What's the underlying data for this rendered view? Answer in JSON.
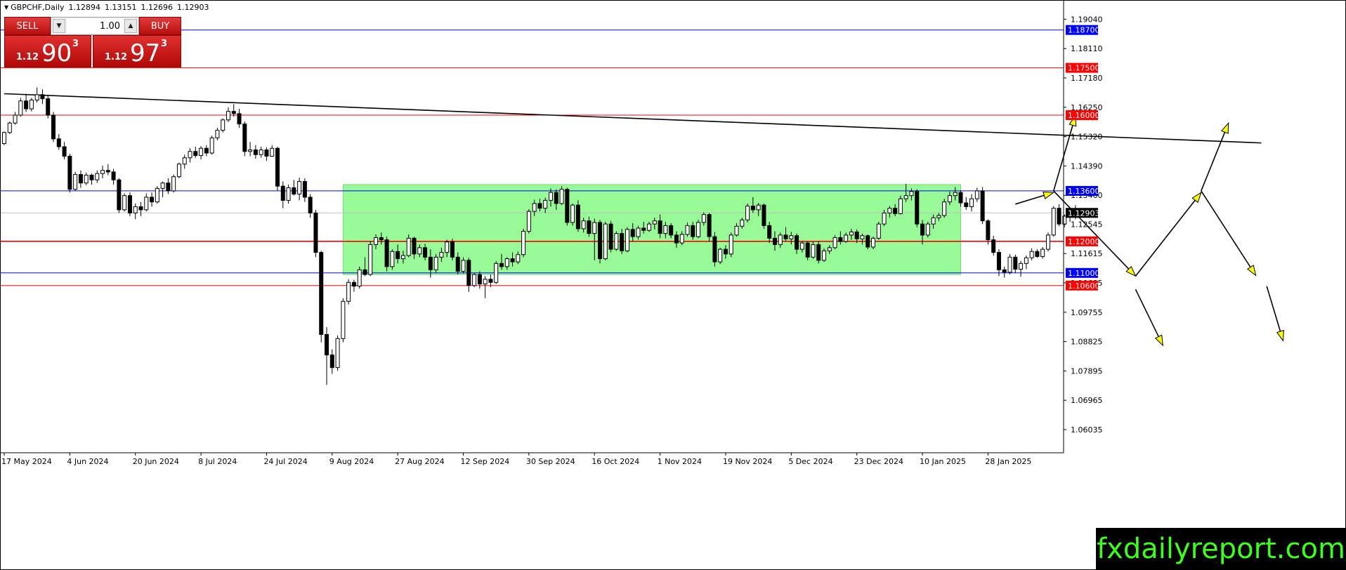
{
  "header": {
    "symbol": "GBPCHF,Daily",
    "open": "1.12894",
    "high": "1.13151",
    "low": "1.12696",
    "close": "1.12903"
  },
  "trade_panel": {
    "sell_label": "SELL",
    "buy_label": "BUY",
    "lot_value": "1.00",
    "sell_price": {
      "small": "1.12",
      "big": "90",
      "sup": "3"
    },
    "buy_price": {
      "small": "1.12",
      "big": "97",
      "sup": "3"
    }
  },
  "brand": "fxdailyreport.com",
  "colors": {
    "background": "#ffffff",
    "bull_candle": "#ffffff",
    "bear_candle": "#000000",
    "range_box": "#98fb98",
    "red_level": "#ff0000",
    "blue_level": "#0000ff",
    "trade_red": "#cc1414",
    "arrow_fill": "#ffff00",
    "brand_text": "#3cff1a"
  },
  "chart_data": {
    "type": "candlestick",
    "title": "GBPCHF,Daily",
    "ylim": [
      1.053,
      1.1965
    ],
    "y_ticks": [
      "1.19040",
      "1.18110",
      "1.17180",
      "1.16250",
      "1.15320",
      "1.14390",
      "1.13460",
      "1.12545",
      "1.11615",
      "1.10685",
      "1.09755",
      "1.08825",
      "1.07895",
      "1.06965",
      "1.06035"
    ],
    "x_labels": [
      "17 May 2024",
      "4 Jun 2024",
      "20 Jun 2024",
      "8 Jul 2024",
      "24 Jul 2024",
      "9 Aug 2024",
      "27 Aug 2024",
      "12 Sep 2024",
      "30 Sep 2024",
      "16 Oct 2024",
      "1 Nov 2024",
      "19 Nov 2024",
      "5 Dec 2024",
      "23 Dec 2024",
      "10 Jan 2025",
      "28 Jan 2025"
    ],
    "x_label_bar_index": [
      0,
      12,
      24,
      36,
      48,
      60,
      72,
      84,
      96,
      108,
      120,
      132,
      144,
      156,
      168,
      180
    ],
    "horizontal_levels": [
      {
        "price": 1.187,
        "label": "1.18700",
        "color": "blue"
      },
      {
        "price": 1.175,
        "label": "1.17500",
        "color": "red"
      },
      {
        "price": 1.16,
        "label": "1.16000",
        "color": "red"
      },
      {
        "price": 1.136,
        "label": "1.13600",
        "color": "blue"
      },
      {
        "price": 1.12,
        "label": "1.12000",
        "color": "red"
      },
      {
        "price": 1.11,
        "label": "1.11000",
        "color": "blue"
      },
      {
        "price": 1.106,
        "label": "1.10600",
        "color": "red"
      }
    ],
    "current_price": {
      "price": 1.12903,
      "label": "1.12903"
    },
    "range_box": {
      "bar_start": 62,
      "bar_end": 175,
      "top": 1.138,
      "bottom": 1.1095
    },
    "trendline": {
      "from": {
        "bar": 0,
        "price": 1.1668
      },
      "to": {
        "bar": 230,
        "price": 1.1512
      }
    },
    "scenario_arrows": [
      [
        {
          "bar": 185,
          "price": 1.1318
        },
        {
          "bar": 192,
          "price": 1.1355
        }
      ],
      [
        {
          "bar": 192,
          "price": 1.136
        },
        {
          "bar": 196,
          "price": 1.1598
        }
      ],
      [
        {
          "bar": 192,
          "price": 1.136
        },
        {
          "bar": 207,
          "price": 1.109
        }
      ],
      [
        {
          "bar": 207,
          "price": 1.109
        },
        {
          "bar": 219,
          "price": 1.1355
        }
      ],
      [
        {
          "bar": 219,
          "price": 1.136
        },
        {
          "bar": 224,
          "price": 1.1575
        }
      ],
      [
        {
          "bar": 219,
          "price": 1.136
        },
        {
          "bar": 229,
          "price": 1.1092
        }
      ],
      [
        {
          "bar": 207,
          "price": 1.1048
        },
        {
          "bar": 212,
          "price": 1.087
        }
      ],
      [
        {
          "bar": 231,
          "price": 1.1058
        },
        {
          "bar": 234,
          "price": 1.0885
        }
      ]
    ],
    "ohlc": [
      [
        1.151,
        1.1548,
        1.1505,
        1.1545
      ],
      [
        1.1545,
        1.158,
        1.154,
        1.1575
      ],
      [
        1.1575,
        1.161,
        1.157,
        1.16
      ],
      [
        1.16,
        1.1655,
        1.1595,
        1.1645
      ],
      [
        1.1645,
        1.1668,
        1.161,
        1.162
      ],
      [
        1.162,
        1.1655,
        1.1612,
        1.1648
      ],
      [
        1.1648,
        1.1688,
        1.164,
        1.1665
      ],
      [
        1.1665,
        1.1682,
        1.1635,
        1.1652
      ],
      [
        1.1652,
        1.1665,
        1.159,
        1.16
      ],
      [
        1.16,
        1.161,
        1.1515,
        1.1525
      ],
      [
        1.1525,
        1.154,
        1.149,
        1.15
      ],
      [
        1.15,
        1.1515,
        1.146,
        1.147
      ],
      [
        1.147,
        1.1478,
        1.1355,
        1.1365
      ],
      [
        1.1365,
        1.142,
        1.136,
        1.1412
      ],
      [
        1.1412,
        1.1425,
        1.137,
        1.1385
      ],
      [
        1.1385,
        1.1418,
        1.1378,
        1.141
      ],
      [
        1.141,
        1.1415,
        1.138,
        1.1395
      ],
      [
        1.1395,
        1.1425,
        1.1385,
        1.1415
      ],
      [
        1.1415,
        1.144,
        1.14,
        1.1425
      ],
      [
        1.1425,
        1.1445,
        1.141,
        1.142
      ],
      [
        1.142,
        1.143,
        1.138,
        1.1395
      ],
      [
        1.1395,
        1.14,
        1.129,
        1.13
      ],
      [
        1.13,
        1.1352,
        1.1295,
        1.1345
      ],
      [
        1.1345,
        1.1355,
        1.128,
        1.129
      ],
      [
        1.129,
        1.132,
        1.127,
        1.131
      ],
      [
        1.131,
        1.1325,
        1.128,
        1.13
      ],
      [
        1.13,
        1.1352,
        1.1295,
        1.134
      ],
      [
        1.134,
        1.1355,
        1.131,
        1.1325
      ],
      [
        1.1325,
        1.1375,
        1.132,
        1.1368
      ],
      [
        1.1368,
        1.139,
        1.134,
        1.1385
      ],
      [
        1.1385,
        1.14,
        1.135,
        1.136
      ],
      [
        1.136,
        1.1412,
        1.1355,
        1.1405
      ],
      [
        1.1405,
        1.145,
        1.14,
        1.1445
      ],
      [
        1.1445,
        1.1475,
        1.143,
        1.1465
      ],
      [
        1.1465,
        1.1495,
        1.145,
        1.1485
      ],
      [
        1.1485,
        1.15,
        1.1465,
        1.1472
      ],
      [
        1.1472,
        1.1502,
        1.146,
        1.1495
      ],
      [
        1.1495,
        1.1505,
        1.147,
        1.148
      ],
      [
        1.148,
        1.1535,
        1.1475,
        1.1528
      ],
      [
        1.1528,
        1.156,
        1.152,
        1.1552
      ],
      [
        1.1552,
        1.159,
        1.1545,
        1.1585
      ],
      [
        1.1585,
        1.1625,
        1.1578,
        1.1612
      ],
      [
        1.1612,
        1.1635,
        1.1595,
        1.1605
      ],
      [
        1.1605,
        1.162,
        1.156,
        1.1572
      ],
      [
        1.1572,
        1.158,
        1.147,
        1.1485
      ],
      [
        1.1485,
        1.1515,
        1.147,
        1.149
      ],
      [
        1.149,
        1.1505,
        1.1462,
        1.1475
      ],
      [
        1.1475,
        1.15,
        1.1465,
        1.149
      ],
      [
        1.149,
        1.1498,
        1.1455,
        1.147
      ],
      [
        1.147,
        1.1505,
        1.1468,
        1.1495
      ],
      [
        1.1495,
        1.15,
        1.136,
        1.1375
      ],
      [
        1.1375,
        1.139,
        1.1305,
        1.133
      ],
      [
        1.133,
        1.138,
        1.132,
        1.137
      ],
      [
        1.137,
        1.1395,
        1.1345,
        1.135
      ],
      [
        1.135,
        1.1402,
        1.133,
        1.139
      ],
      [
        1.139,
        1.14,
        1.1325,
        1.134
      ],
      [
        1.134,
        1.135,
        1.1275,
        1.129
      ],
      [
        1.129,
        1.13,
        1.115,
        1.1165
      ],
      [
        1.1165,
        1.117,
        1.088,
        1.0905
      ],
      [
        1.0905,
        1.0928,
        1.0745,
        1.084
      ],
      [
        1.084,
        1.0858,
        1.078,
        1.08
      ],
      [
        1.08,
        1.0902,
        1.079,
        1.0892
      ],
      [
        1.0892,
        1.102,
        1.088,
        1.101
      ],
      [
        1.101,
        1.108,
        1.1,
        1.107
      ],
      [
        1.107,
        1.1078,
        1.104,
        1.1058
      ],
      [
        1.1058,
        1.112,
        1.105,
        1.111
      ],
      [
        1.111,
        1.115,
        1.109,
        1.1095
      ],
      [
        1.1095,
        1.12,
        1.109,
        1.119
      ],
      [
        1.119,
        1.1222,
        1.1175,
        1.1212
      ],
      [
        1.1212,
        1.1228,
        1.119,
        1.1205
      ],
      [
        1.1205,
        1.1215,
        1.1105,
        1.112
      ],
      [
        1.112,
        1.1175,
        1.111,
        1.1168
      ],
      [
        1.1168,
        1.119,
        1.113,
        1.1145
      ],
      [
        1.1145,
        1.117,
        1.113,
        1.1155
      ],
      [
        1.1155,
        1.1222,
        1.115,
        1.121
      ],
      [
        1.121,
        1.1215,
        1.1145,
        1.116
      ],
      [
        1.116,
        1.119,
        1.115,
        1.118
      ],
      [
        1.118,
        1.1192,
        1.114,
        1.115
      ],
      [
        1.115,
        1.1175,
        1.1085,
        1.111
      ],
      [
        1.111,
        1.116,
        1.11,
        1.115
      ],
      [
        1.115,
        1.118,
        1.1135,
        1.1165
      ],
      [
        1.1165,
        1.1205,
        1.115,
        1.1198
      ],
      [
        1.1198,
        1.1208,
        1.114,
        1.115
      ],
      [
        1.115,
        1.1165,
        1.1095,
        1.1105
      ],
      [
        1.1105,
        1.115,
        1.1098,
        1.114
      ],
      [
        1.114,
        1.1148,
        1.104,
        1.106
      ],
      [
        1.106,
        1.11,
        1.1055,
        1.1095
      ],
      [
        1.1095,
        1.1105,
        1.105,
        1.1065
      ],
      [
        1.1065,
        1.109,
        1.102,
        1.108
      ],
      [
        1.108,
        1.1095,
        1.1055,
        1.107
      ],
      [
        1.107,
        1.1138,
        1.1065,
        1.113
      ],
      [
        1.113,
        1.116,
        1.111,
        1.112
      ],
      [
        1.112,
        1.115,
        1.111,
        1.1145
      ],
      [
        1.1145,
        1.1165,
        1.112,
        1.1135
      ],
      [
        1.1135,
        1.1168,
        1.1128,
        1.1158
      ],
      [
        1.1158,
        1.124,
        1.115,
        1.1232
      ],
      [
        1.1232,
        1.1302,
        1.1225,
        1.1295
      ],
      [
        1.1295,
        1.1332,
        1.128,
        1.132
      ],
      [
        1.132,
        1.1335,
        1.1295,
        1.1305
      ],
      [
        1.1305,
        1.1338,
        1.129,
        1.133
      ],
      [
        1.133,
        1.1368,
        1.131,
        1.1355
      ],
      [
        1.1355,
        1.1365,
        1.13,
        1.132
      ],
      [
        1.132,
        1.1375,
        1.1315,
        1.1365
      ],
      [
        1.1365,
        1.137,
        1.125,
        1.126
      ],
      [
        1.126,
        1.132,
        1.125,
        1.1315
      ],
      [
        1.1315,
        1.133,
        1.123,
        1.124
      ],
      [
        1.124,
        1.1275,
        1.1228,
        1.1265
      ],
      [
        1.1265,
        1.1278,
        1.1215,
        1.1225
      ],
      [
        1.1225,
        1.1272,
        1.114,
        1.126
      ],
      [
        1.126,
        1.1268,
        1.113,
        1.1145
      ],
      [
        1.1145,
        1.1262,
        1.114,
        1.1255
      ],
      [
        1.1255,
        1.1265,
        1.1165,
        1.1175
      ],
      [
        1.1175,
        1.1232,
        1.117,
        1.1225
      ],
      [
        1.1225,
        1.124,
        1.116,
        1.117
      ],
      [
        1.117,
        1.1245,
        1.1165,
        1.1238
      ],
      [
        1.1238,
        1.1258,
        1.12,
        1.1215
      ],
      [
        1.1215,
        1.125,
        1.1205,
        1.1242
      ],
      [
        1.1242,
        1.1262,
        1.1225,
        1.1235
      ],
      [
        1.1235,
        1.1262,
        1.123,
        1.1255
      ],
      [
        1.1255,
        1.1275,
        1.1238,
        1.1265
      ],
      [
        1.1265,
        1.1285,
        1.121,
        1.1225
      ],
      [
        1.1225,
        1.1262,
        1.121,
        1.125
      ],
      [
        1.125,
        1.1258,
        1.121,
        1.122
      ],
      [
        1.122,
        1.1232,
        1.118,
        1.1195
      ],
      [
        1.1195,
        1.1232,
        1.1188,
        1.1222
      ],
      [
        1.1222,
        1.126,
        1.1215,
        1.125
      ],
      [
        1.125,
        1.1262,
        1.1205,
        1.1215
      ],
      [
        1.1215,
        1.1268,
        1.121,
        1.126
      ],
      [
        1.126,
        1.1292,
        1.125,
        1.1285
      ],
      [
        1.1285,
        1.129,
        1.12,
        1.1215
      ],
      [
        1.1215,
        1.123,
        1.112,
        1.1135
      ],
      [
        1.1135,
        1.118,
        1.1128,
        1.1175
      ],
      [
        1.1175,
        1.1188,
        1.1145,
        1.116
      ],
      [
        1.116,
        1.1228,
        1.115,
        1.122
      ],
      [
        1.122,
        1.1258,
        1.1215,
        1.1248
      ],
      [
        1.1248,
        1.1275,
        1.124,
        1.1268
      ],
      [
        1.1268,
        1.132,
        1.126,
        1.1312
      ],
      [
        1.1312,
        1.134,
        1.129,
        1.13
      ],
      [
        1.13,
        1.1322,
        1.128,
        1.1315
      ],
      [
        1.1315,
        1.132,
        1.124,
        1.125
      ],
      [
        1.125,
        1.1262,
        1.1195,
        1.121
      ],
      [
        1.121,
        1.1232,
        1.117,
        1.119
      ],
      [
        1.119,
        1.1228,
        1.118,
        1.122
      ],
      [
        1.122,
        1.1245,
        1.12,
        1.1208
      ],
      [
        1.1208,
        1.123,
        1.119,
        1.1218
      ],
      [
        1.1218,
        1.1225,
        1.116,
        1.1175
      ],
      [
        1.1175,
        1.12,
        1.1165,
        1.1195
      ],
      [
        1.1195,
        1.12,
        1.114,
        1.115
      ],
      [
        1.115,
        1.12,
        1.1145,
        1.119
      ],
      [
        1.119,
        1.12,
        1.113,
        1.114
      ],
      [
        1.114,
        1.1178,
        1.1135,
        1.117
      ],
      [
        1.117,
        1.1188,
        1.116,
        1.118
      ],
      [
        1.118,
        1.122,
        1.1175,
        1.1212
      ],
      [
        1.1212,
        1.1232,
        1.119,
        1.12
      ],
      [
        1.12,
        1.1228,
        1.1195,
        1.122
      ],
      [
        1.122,
        1.124,
        1.1205,
        1.123
      ],
      [
        1.123,
        1.1238,
        1.1195,
        1.1208
      ],
      [
        1.1208,
        1.1225,
        1.119,
        1.1218
      ],
      [
        1.1218,
        1.1222,
        1.1175,
        1.1182
      ],
      [
        1.1182,
        1.1215,
        1.1175,
        1.121
      ],
      [
        1.121,
        1.1262,
        1.1205,
        1.1255
      ],
      [
        1.1255,
        1.13,
        1.1248,
        1.129
      ],
      [
        1.129,
        1.1312,
        1.1275,
        1.1305
      ],
      [
        1.1305,
        1.1318,
        1.128,
        1.1288
      ],
      [
        1.1288,
        1.1345,
        1.1285,
        1.1335
      ],
      [
        1.1335,
        1.1382,
        1.1325,
        1.1345
      ],
      [
        1.1345,
        1.1368,
        1.133,
        1.1358
      ],
      [
        1.1358,
        1.1365,
        1.1245,
        1.1255
      ],
      [
        1.1255,
        1.1268,
        1.119,
        1.122
      ],
      [
        1.122,
        1.1262,
        1.1212,
        1.1255
      ],
      [
        1.1255,
        1.1285,
        1.124,
        1.1275
      ],
      [
        1.1275,
        1.129,
        1.1265,
        1.1282
      ],
      [
        1.1282,
        1.1335,
        1.1275,
        1.1325
      ],
      [
        1.1325,
        1.1358,
        1.1315,
        1.1345
      ],
      [
        1.1345,
        1.1372,
        1.133,
        1.1355
      ],
      [
        1.1355,
        1.1362,
        1.131,
        1.1322
      ],
      [
        1.1322,
        1.134,
        1.13,
        1.131
      ],
      [
        1.131,
        1.135,
        1.1295,
        1.1335
      ],
      [
        1.1335,
        1.137,
        1.1325,
        1.136
      ],
      [
        1.136,
        1.1372,
        1.1255,
        1.1265
      ],
      [
        1.1265,
        1.127,
        1.119,
        1.1205
      ],
      [
        1.1205,
        1.1218,
        1.1155,
        1.1165
      ],
      [
        1.1165,
        1.1175,
        1.109,
        1.111
      ],
      [
        1.111,
        1.112,
        1.1085,
        1.1102
      ],
      [
        1.1102,
        1.116,
        1.1095,
        1.115
      ],
      [
        1.115,
        1.1158,
        1.11,
        1.1112
      ],
      [
        1.1112,
        1.1138,
        1.1088,
        1.113
      ],
      [
        1.113,
        1.1155,
        1.1112,
        1.1148
      ],
      [
        1.1148,
        1.1178,
        1.114,
        1.1168
      ],
      [
        1.1168,
        1.1175,
        1.1148,
        1.1152
      ],
      [
        1.1152,
        1.1182,
        1.1145,
        1.1175
      ],
      [
        1.1175,
        1.1228,
        1.1168,
        1.122
      ],
      [
        1.122,
        1.1312,
        1.1215,
        1.1305
      ],
      [
        1.1305,
        1.1318,
        1.1248,
        1.1255
      ],
      [
        1.1255,
        1.1285,
        1.1245,
        1.128
      ],
      [
        1.128,
        1.13,
        1.1262,
        1.1292
      ],
      [
        1.1292,
        1.1315,
        1.127,
        1.129
      ]
    ]
  }
}
